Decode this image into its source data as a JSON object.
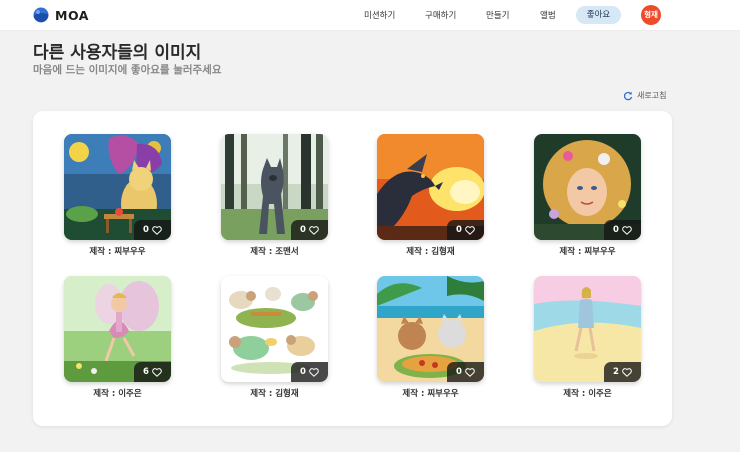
{
  "app": {
    "name": "MOA"
  },
  "nav": {
    "items": [
      "미션하기",
      "구매하기",
      "만들기",
      "앨범"
    ],
    "active": "좋아요",
    "avatar": "형재"
  },
  "page": {
    "title": "다른 사용자들의 이미지",
    "subtitle": "마음에 드는 이미지에 좋아요를 눌러주세요",
    "refresh_label": "새로고침"
  },
  "gallery": [
    {
      "creator": "제작 : 찌부우우",
      "likes": "0",
      "scene": "cat-fairy-cafe"
    },
    {
      "creator": "제작 : 조맨서",
      "likes": "0",
      "scene": "forest-wolf"
    },
    {
      "creator": "제작 : 김형재",
      "likes": "0",
      "scene": "fire-dragon"
    },
    {
      "creator": "제작 : 찌부우우",
      "likes": "0",
      "scene": "flower-fairy"
    },
    {
      "creator": "제작 : 이주은",
      "likes": "6",
      "scene": "dancing-fairy"
    },
    {
      "creator": "제작 : 김형재",
      "likes": "0",
      "scene": "sheep-picnic"
    },
    {
      "creator": "제작 : 찌부우우",
      "likes": "0",
      "scene": "beach-cats-pizza"
    },
    {
      "creator": "제작 : 이주은",
      "likes": "2",
      "scene": "beach-walk"
    }
  ]
}
